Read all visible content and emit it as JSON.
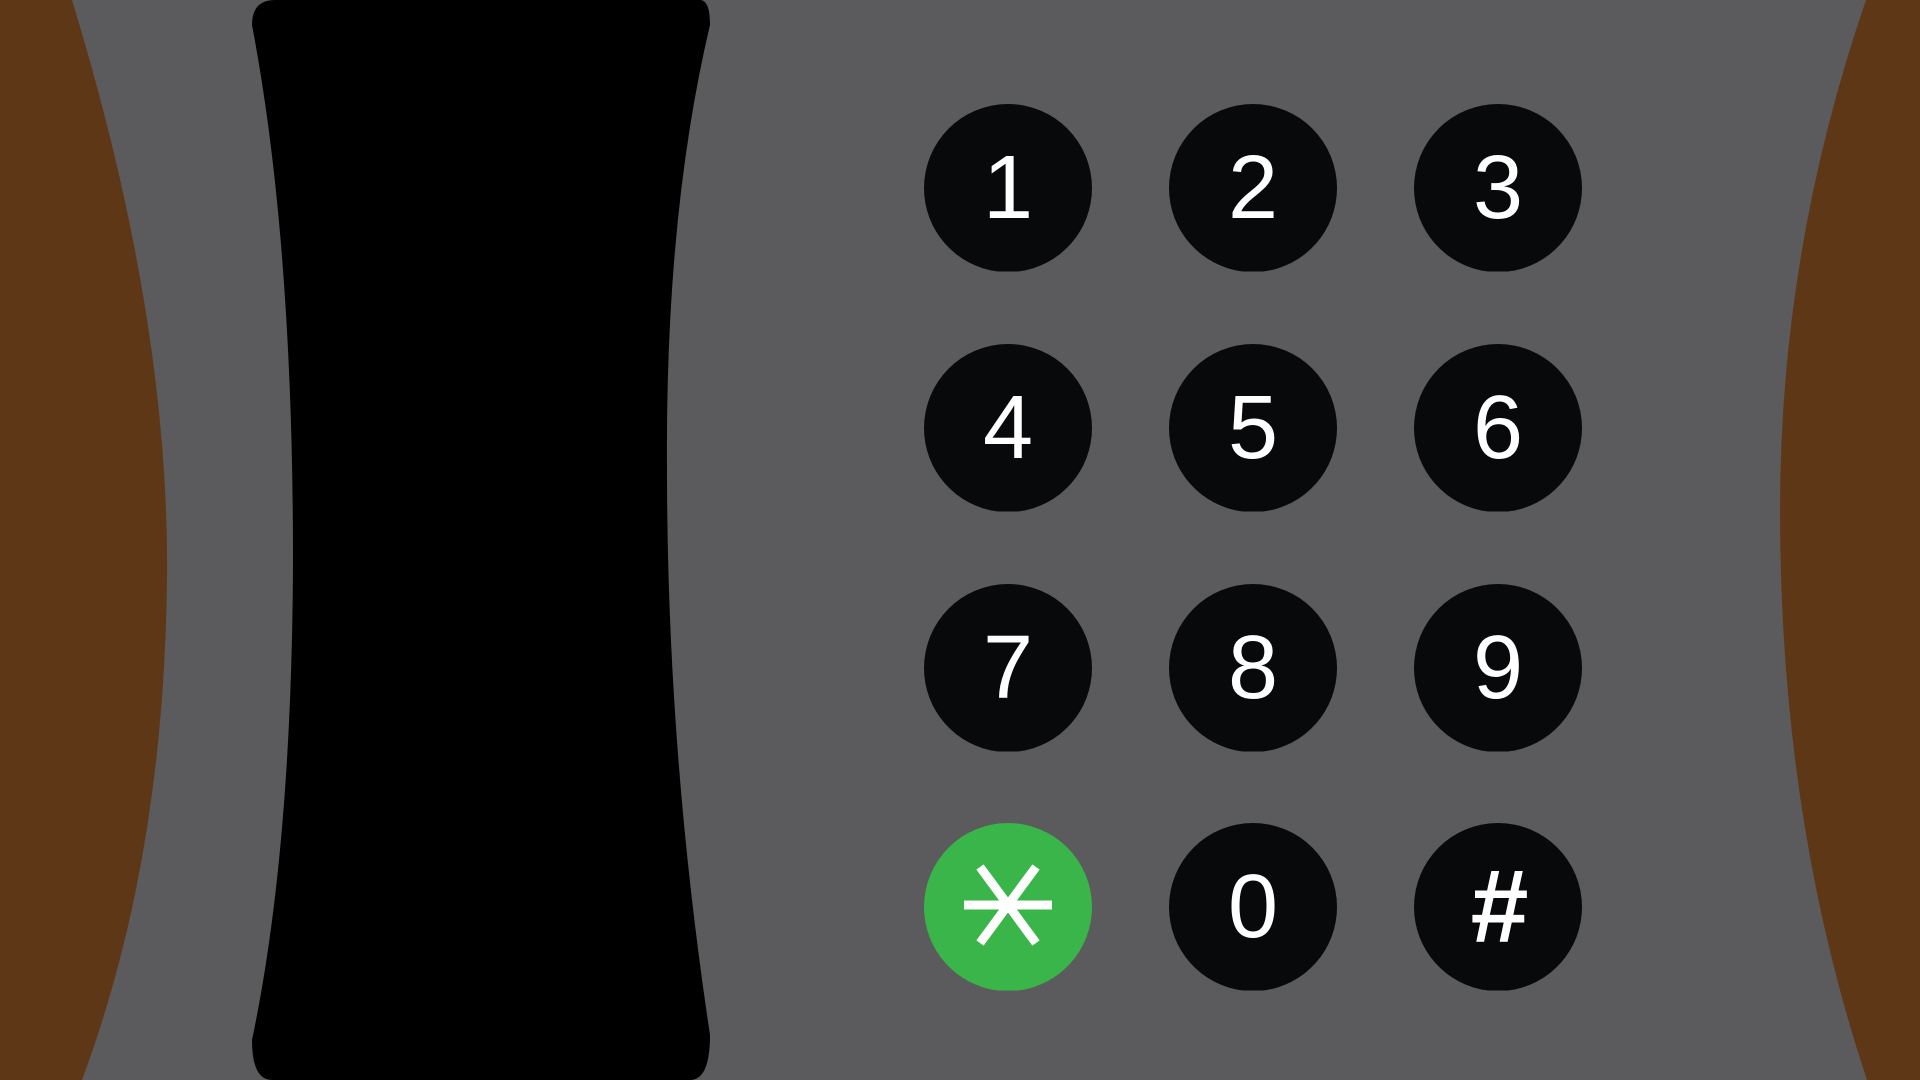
{
  "colors": {
    "background": "#5b5b5d",
    "wood": "#5e3816",
    "handset": "#000000",
    "key": "#08090b",
    "key_active": "#39b54a",
    "label": "#ffffff"
  },
  "handset": {
    "icon": "telephone-handset"
  },
  "keypad": {
    "keys": [
      {
        "label": "1",
        "name": "key-1"
      },
      {
        "label": "2",
        "name": "key-2"
      },
      {
        "label": "3",
        "name": "key-3"
      },
      {
        "label": "4",
        "name": "key-4"
      },
      {
        "label": "5",
        "name": "key-5"
      },
      {
        "label": "6",
        "name": "key-6"
      },
      {
        "label": "7",
        "name": "key-7"
      },
      {
        "label": "8",
        "name": "key-8"
      },
      {
        "label": "9",
        "name": "key-9"
      },
      {
        "label": "*",
        "name": "key-star",
        "active": true,
        "icon": "asterisk-icon"
      },
      {
        "label": "0",
        "name": "key-0"
      },
      {
        "label": "#",
        "name": "key-hash"
      }
    ]
  }
}
